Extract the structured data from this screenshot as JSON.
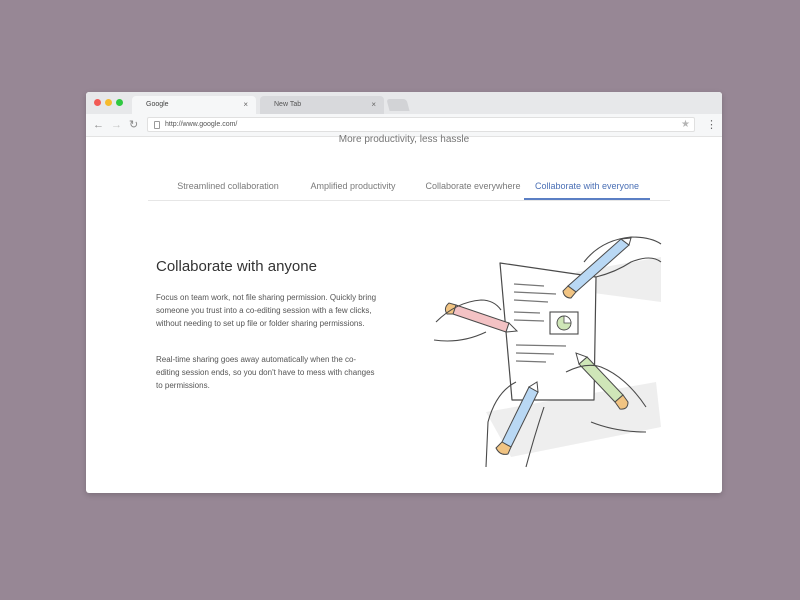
{
  "browser": {
    "tabs": [
      {
        "title": "Google",
        "close": "×"
      },
      {
        "title": "New Tab",
        "close": "×"
      }
    ],
    "nav": {
      "back": "←",
      "forward": "→",
      "reload": "↻"
    },
    "address_url": "http://www.google.com/",
    "bookmark_star": "★",
    "menu_icon": "⋮"
  },
  "page": {
    "subtitle": "More productivity, less hassle",
    "tabs": [
      {
        "label": "Streamlined collaboration"
      },
      {
        "label": "Amplified productivity"
      },
      {
        "label": "Collaborate everywhere"
      },
      {
        "label": "Collaborate with everyone",
        "active": true
      }
    ],
    "heading": "Collaborate with anyone",
    "paragraphs": [
      "Focus on team work, not file sharing permission. Quickly bring someone you trust into a co-editing session with a few clicks, without needing to set up file or folder sharing permissions.",
      "Real-time sharing goes away automatically when the co-editing session ends, so you don't have to mess with changes to permissions."
    ]
  },
  "colors": {
    "background": "#978795",
    "active_tab": "#4a6fb5",
    "pencil_blue": "#b9d8f4",
    "pencil_pink": "#f3c2c4",
    "pencil_green": "#cfe6b8",
    "pencil_tip": "#f1c483"
  }
}
